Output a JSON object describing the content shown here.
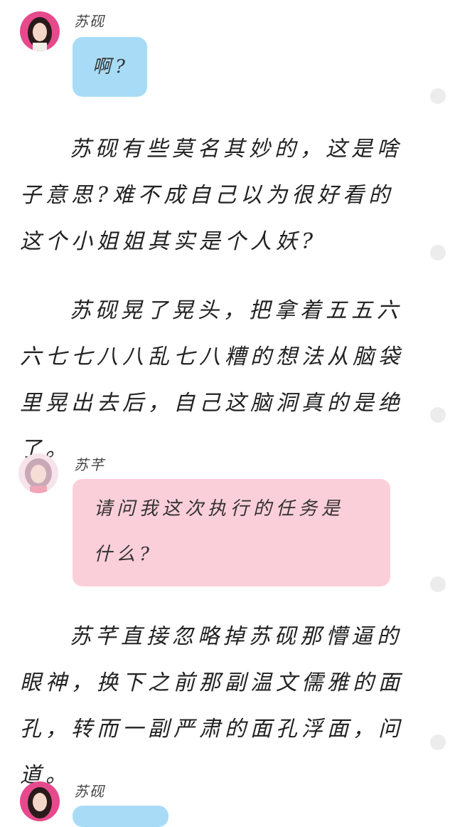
{
  "messages": [
    {
      "sender": "苏砚",
      "text": "啊?"
    },
    {
      "sender": "苏芊",
      "text_line1": "请问我这次执行的任务是",
      "text_line2": "什么?"
    },
    {
      "sender": "苏砚",
      "text": ""
    }
  ],
  "paragraphs": [
    "苏砚有些莫名其妙的，这是啥子意思?难不成自己以为很好看的这个小姐姐其实是个人妖?",
    "苏砚晃了晃头，把拿着五五六六七七八八乱七八糟的想法从脑袋里晃出去后，自己这脑洞真的是绝了。",
    "苏芊直接忽略掉苏砚那懵逼的眼神，换下之前那副温文儒雅的面孔，转而一副严肃的面孔浮面，问道。"
  ],
  "colors": {
    "bubble_blue": "#a8dcf6",
    "bubble_pink": "#fbcfd9",
    "scroll_dot": "#ececec"
  }
}
